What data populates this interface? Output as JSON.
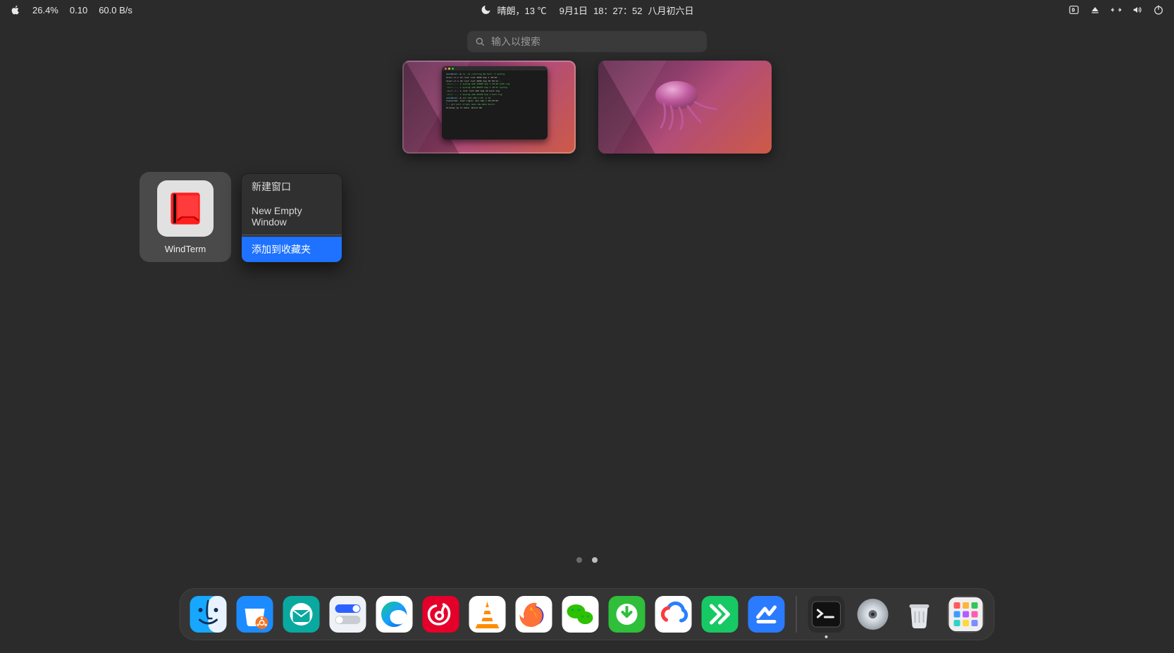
{
  "topbar": {
    "cpu_percent": "26.4%",
    "load_avg": "0.10",
    "net_speed": "60.0 B/s",
    "weather_text": "晴朗，13 ℃",
    "date": "9月1日",
    "time": "18：27：52",
    "lunar": "八月初六日"
  },
  "search": {
    "placeholder": "输入以搜索"
  },
  "workspaces": {
    "count": 2,
    "active_index": 0
  },
  "app_tile": {
    "name": "WindTerm"
  },
  "context_menu": {
    "items": [
      {
        "label": "新建窗口",
        "highlight": false
      },
      {
        "label": "New Empty Window",
        "highlight": false
      }
    ],
    "after_divider": [
      {
        "label": "添加到收藏夹",
        "highlight": true
      }
    ]
  },
  "pages": {
    "count": 2,
    "current": 1
  },
  "dock": {
    "apps": [
      {
        "id": "finder",
        "name": "finder-icon"
      },
      {
        "id": "software",
        "name": "software-store-icon"
      },
      {
        "id": "mail",
        "name": "mail-icon"
      },
      {
        "id": "toggle",
        "name": "settings-pill-icon"
      },
      {
        "id": "edge",
        "name": "edge-browser-icon"
      },
      {
        "id": "netease",
        "name": "netease-music-icon"
      },
      {
        "id": "vlc",
        "name": "vlc-icon"
      },
      {
        "id": "firefox",
        "name": "firefox-icon"
      },
      {
        "id": "wechat",
        "name": "wechat-icon"
      },
      {
        "id": "download",
        "name": "downloader-icon"
      },
      {
        "id": "baidu",
        "name": "baidu-netdisk-icon"
      },
      {
        "id": "edraw",
        "name": "edrawmind-icon"
      },
      {
        "id": "todesk",
        "name": "todesk-icon"
      }
    ],
    "right_group": [
      {
        "id": "terminal",
        "name": "terminal-icon"
      },
      {
        "id": "disc",
        "name": "disc-icon"
      },
      {
        "id": "trash",
        "name": "trash-icon"
      },
      {
        "id": "launchpad",
        "name": "launchpad-icon",
        "boxed": true
      }
    ]
  }
}
